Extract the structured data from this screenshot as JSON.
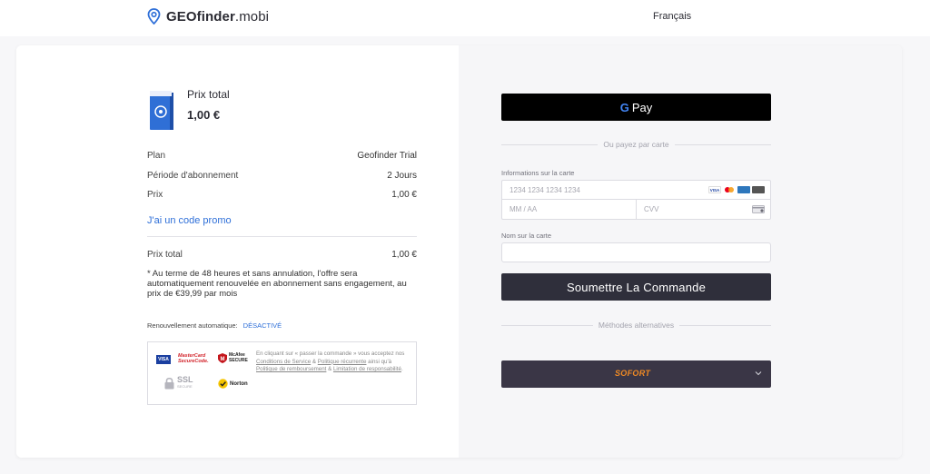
{
  "header": {
    "logo_bold": "GEOfinder",
    "logo_light": ".mobi",
    "language": "Français"
  },
  "order": {
    "title": "Prix total",
    "price": "1,00 €",
    "rows": [
      {
        "label": "Plan",
        "value": "Geofinder Trial"
      },
      {
        "label": "Période d'abonnement",
        "value": "2 Jours"
      },
      {
        "label": "Prix",
        "value": "1,00 €"
      }
    ],
    "promo_link": "J'ai un code promo",
    "total_label": "Prix total",
    "total_value": "1,00 €",
    "note": "* Au terme de 48 heures et sans annulation, l'offre sera automatiquement renouvelée en abonnement sans engagement, au prix de €39,99 par mois",
    "renewal_label": "Renouvellement automatique:",
    "renewal_state": "DÉSACTIVÉ"
  },
  "trust": {
    "visa": "VISA",
    "mastercard": "MasterCard SecureCode.",
    "mcafee": "McAfee SECURE",
    "ssl": "SSL",
    "ssl_sub": "SECURE",
    "norton": "Norton",
    "legal_1": "En cliquant sur « passer la commande » vous acceptez nos ",
    "legal_link_1": "Conditions de Service",
    "legal_2": " & ",
    "legal_link_2": "Politique récurrente",
    "legal_3": " ainsi qu'à ",
    "legal_link_3": "Politique de remboursement",
    "legal_4": " & ",
    "legal_link_4": "Limitation de responsabilité",
    "legal_5": "."
  },
  "payment": {
    "gpay_g": "G",
    "gpay_label": "Pay",
    "or_card": "Ou payez par carte",
    "card_info_label": "Informations sur la carte",
    "card_number_placeholder": "1234 1234 1234 1234",
    "expiry_placeholder": "MM / AA",
    "cvv_placeholder": "CVV",
    "brands": [
      "VISA",
      "MC",
      "AMEX",
      "DISC"
    ],
    "name_label": "Nom sur la carte",
    "name_value": "",
    "submit": "Soumettre La Commande",
    "alt_methods": "Méthodes alternatives",
    "sofort": "SOFORT"
  },
  "colors": {
    "accent_blue": "#2e6fd8",
    "submit_bg": "#2f2f3b",
    "sofort_orange": "#f08a24"
  }
}
